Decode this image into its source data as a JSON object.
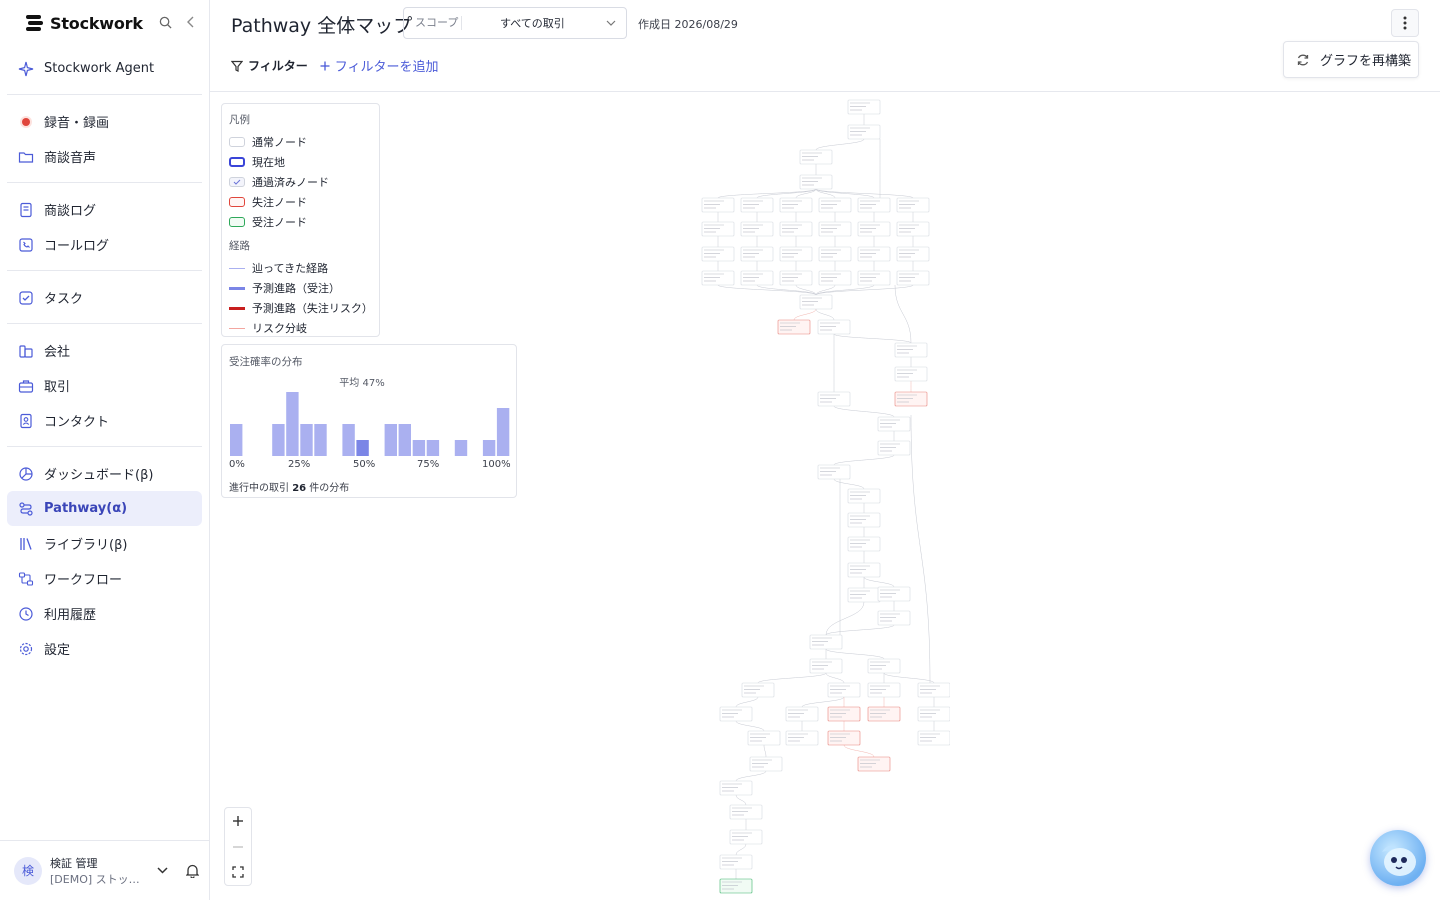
{
  "app": {
    "brand": "Stockwork"
  },
  "sidebar": {
    "items": [
      {
        "label": "Stockwork Agent",
        "icon": "sparkle-icon"
      },
      {
        "label": "録音・録画",
        "icon": "record-icon"
      },
      {
        "label": "商談音声",
        "icon": "folder-icon"
      },
      {
        "label": "商談ログ",
        "icon": "log-icon"
      },
      {
        "label": "コールログ",
        "icon": "phone-icon"
      },
      {
        "label": "タスク",
        "icon": "task-icon"
      },
      {
        "label": "会社",
        "icon": "building-icon"
      },
      {
        "label": "取引",
        "icon": "briefcase-icon"
      },
      {
        "label": "コンタクト",
        "icon": "contact-icon"
      },
      {
        "label": "ダッシュボード(β)",
        "icon": "dashboard-icon"
      },
      {
        "label": "Pathway(α)",
        "icon": "pathway-icon",
        "active": true
      },
      {
        "label": "ライブラリ(β)",
        "icon": "library-icon"
      },
      {
        "label": "ワークフロー",
        "icon": "workflow-icon"
      },
      {
        "label": "利用履歴",
        "icon": "history-icon"
      },
      {
        "label": "設定",
        "icon": "gear-icon"
      }
    ],
    "user": {
      "initial": "検",
      "name": "検証 管理",
      "org": "[DEMO] ストックワーク"
    }
  },
  "header": {
    "title": "Pathway 全体マップ",
    "scope_label": "スコープ",
    "scope_value": "すべての取引",
    "created": "作成日 2026/08/29",
    "filter_label": "フィルター",
    "add_filter_label": "フィルターを追加",
    "rebuild_label": "グラフを再構築"
  },
  "legend": {
    "title": "凡例",
    "nodes": [
      {
        "label": "通常ノード",
        "style": "normal"
      },
      {
        "label": "現在地",
        "style": "current"
      },
      {
        "label": "通過済みノード",
        "style": "passed"
      },
      {
        "label": "失注ノード",
        "style": "lost"
      },
      {
        "label": "受注ノード",
        "style": "won"
      }
    ],
    "paths_title": "経路",
    "paths": [
      {
        "label": "辿ってきた経路",
        "style": "traveled"
      },
      {
        "label": "予測進路（受注）",
        "style": "predict-win"
      },
      {
        "label": "予測進路（失注リスク）",
        "style": "predict-lose"
      },
      {
        "label": "リスク分岐",
        "style": "risk"
      }
    ]
  },
  "distribution": {
    "title": "受注確率の分布",
    "average": "平均 47%",
    "ticks": [
      "0%",
      "25%",
      "50%",
      "75%",
      "100%"
    ],
    "footer_prefix": "進行中の取引",
    "footer_count": "26",
    "footer_suffix": "件の分布",
    "colors": {
      "bar": "#aab0f0",
      "highlight": "#7b85e6"
    }
  },
  "chart_data": {
    "type": "bar",
    "title": "受注確率の分布",
    "xlabel": "",
    "ylabel": "",
    "categories": [
      "0%",
      "5%",
      "10%",
      "15%",
      "20%",
      "25%",
      "30%",
      "35%",
      "40%",
      "45%",
      "50%",
      "55%",
      "60%",
      "65%",
      "70%",
      "75%",
      "80%",
      "85%",
      "90%",
      "95%",
      "100%"
    ],
    "values": [
      2,
      0,
      0,
      2,
      4,
      2,
      2,
      0,
      2,
      1,
      0,
      2,
      2,
      1,
      1,
      0,
      1,
      0,
      1,
      3,
      0
    ],
    "highlight_index": 9,
    "ylim": [
      0,
      4
    ]
  },
  "colors": {
    "accent": "#4b5bd8",
    "sidebar_active_bg": "#eceefb",
    "lost": "#e0463c",
    "won": "#2ea85a"
  }
}
